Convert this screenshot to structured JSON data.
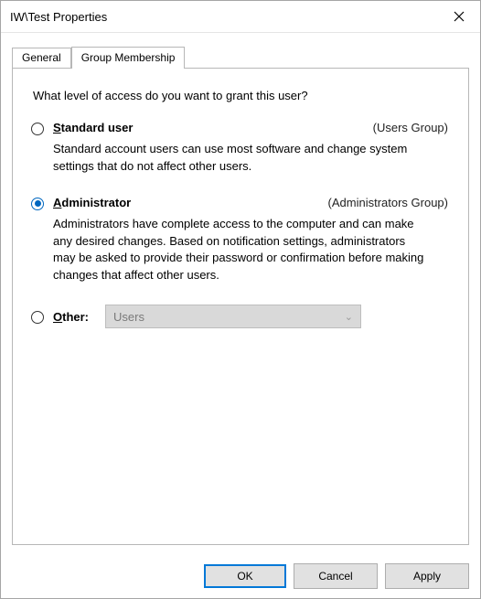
{
  "window": {
    "title": "IW\\Test Properties"
  },
  "tabs": {
    "general": "General",
    "group_membership": "Group Membership"
  },
  "panel": {
    "question": "What level of access do you want to grant this user?",
    "options": {
      "standard": {
        "label_pre": "S",
        "label_key": "",
        "label_post": "tandard user",
        "group": "(Users Group)",
        "desc": "Standard account users can use most software and change system settings that do not affect other users.",
        "selected": false
      },
      "admin": {
        "label_pre": "",
        "label_key": "A",
        "label_post": "dministrator",
        "group": "(Administrators Group)",
        "desc": "Administrators have complete access to the computer and can make any desired changes. Based on notification settings, administrators may be asked to provide their password or confirmation before making changes that affect other users.",
        "selected": true
      },
      "other": {
        "label_pre": "",
        "label_key": "O",
        "label_post": "ther:",
        "combo_value": "Users",
        "selected": false
      }
    }
  },
  "buttons": {
    "ok": "OK",
    "cancel": "Cancel",
    "apply": "Apply"
  }
}
